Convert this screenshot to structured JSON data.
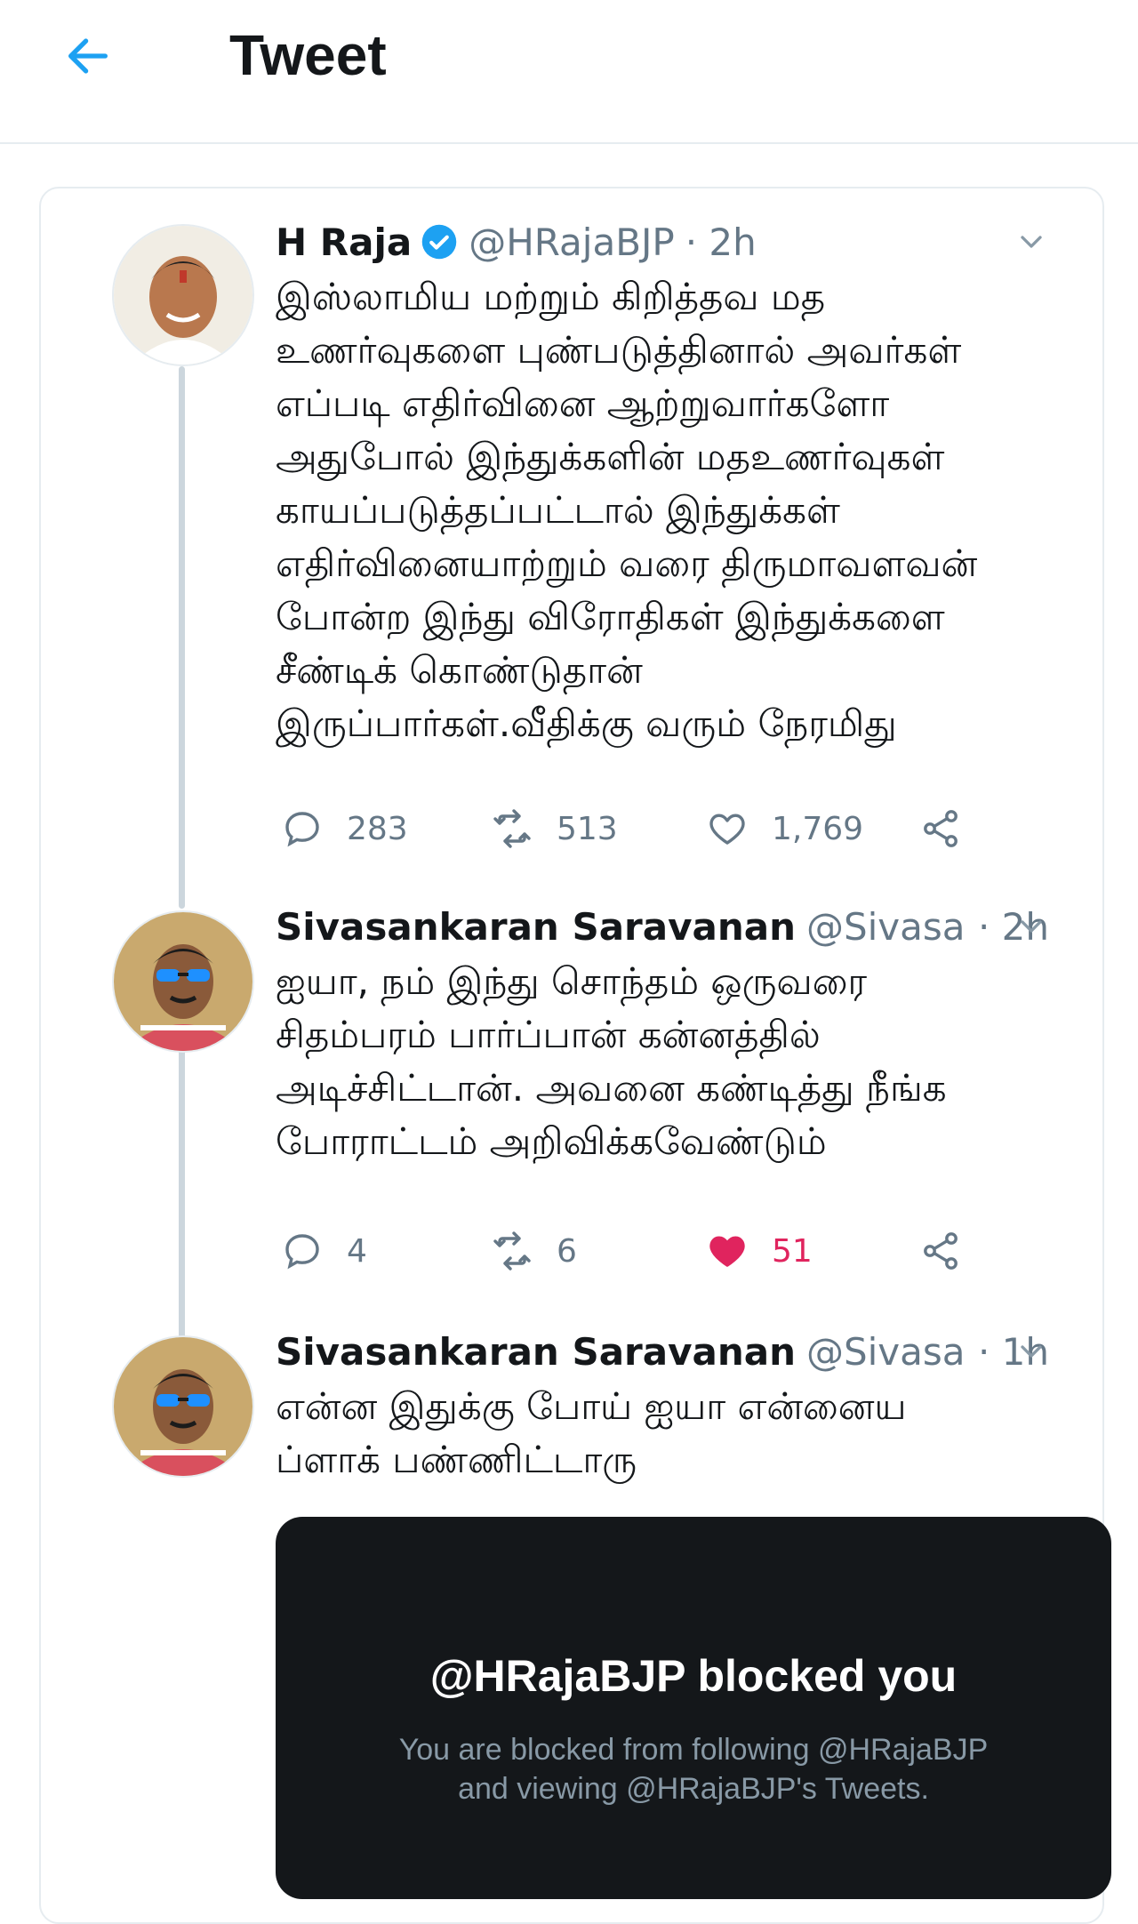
{
  "header": {
    "title": "Tweet",
    "accent": "#1da1f2"
  },
  "tweets": [
    {
      "name": "H Raja",
      "verified": true,
      "handle": "@HRajaBJP",
      "time": "· 2h",
      "text": "இஸ்லாமிய மற்றும் கிறித்தவ மத\nஉணர்வுகளை புண்படுத்தினால் அவர்கள்\nஎப்படி எதிர்வினை ஆற்றுவார்களோ\nஅதுபோல் இந்துக்களின் மதஉணர்வுகள்\nகாயப்படுத்தப்பட்டால் இந்துக்கள்\nஎதிர்வினையாற்றும் வரை திருமாவளவன்\nபோன்ற இந்து விரோதிகள் இந்துக்களை\nசீண்டிக் கொண்டுதான்\nஇருப்பார்கள்.வீதிக்கு வரும் நேரமிது",
      "replies": "283",
      "retweets": "513",
      "likes": "1,769",
      "liked": false
    },
    {
      "name": "Sivasankaran Saravanan",
      "verified": false,
      "handle": "@Sivasan...",
      "time": "· 2h",
      "text": "ஐயா, நம் இந்து சொந்தம் ஒருவரை\nசிதம்பரம் பார்ப்பான் கன்னத்தில்\nஅடிச்சிட்டான். அவனை கண்டித்து நீங்க\nபோராட்டம் அறிவிக்கவேண்டும்",
      "replies": "4",
      "retweets": "6",
      "likes": "51",
      "liked": true
    },
    {
      "name": "Sivasankaran Saravanan",
      "verified": false,
      "handle": "@Sivasan...",
      "time": "· 1h",
      "text": "என்ன இதுக்கு போய் ஐயா என்னைய\nப்ளாக் பண்ணிட்டாரு"
    }
  ],
  "blocked_card": {
    "title": "@HRajaBJP blocked you",
    "line1": "You are blocked from following @HRajaBJP",
    "line2": "and viewing @HRajaBJP's Tweets."
  },
  "colors": {
    "text": "#14171a",
    "secondary": "#657786",
    "like": "#e0245e",
    "card_dark": "#14171a"
  },
  "icons": [
    "back-arrow-icon",
    "verified-badge-icon",
    "chevron-down-icon",
    "reply-icon",
    "retweet-icon",
    "heart-icon",
    "share-icon"
  ]
}
